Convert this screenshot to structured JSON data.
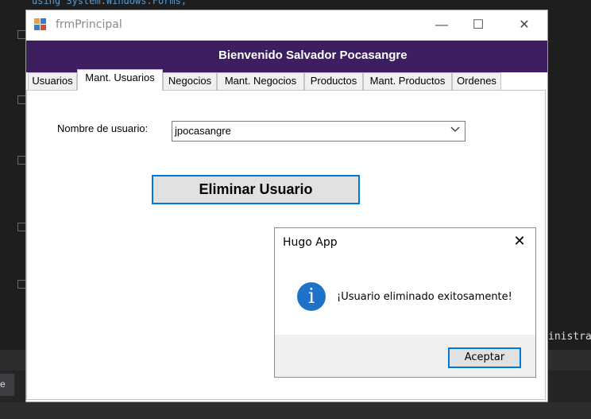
{
  "window": {
    "title": "frmPrincipal",
    "minimize": "—",
    "maximize": "☐",
    "close": "✕"
  },
  "header": {
    "welcome": "Bienvenido Salvador Pocasangre"
  },
  "tabs": [
    {
      "label": "Usuarios"
    },
    {
      "label": "Mant. Usuarios"
    },
    {
      "label": "Negocios"
    },
    {
      "label": "Mant. Negocios"
    },
    {
      "label": "Productos"
    },
    {
      "label": "Mant. Productos"
    },
    {
      "label": "Ordenes"
    }
  ],
  "form": {
    "user_label": "Nombre de usuario:",
    "user_value": "jpocasangre",
    "delete_button": "Eliminar Usuario"
  },
  "messagebox": {
    "title": "Hugo App",
    "message": "¡Usuario eliminado exitosamente!",
    "ok_button": "Aceptar",
    "close": "✕",
    "icon": "info-icon",
    "icon_glyph": "i"
  },
  "ide": {
    "code_fragment": "using System.Windows.Forms;",
    "right_text": "inistra",
    "tab_text": "e"
  },
  "colors": {
    "header_bg": "#3d1f5f",
    "accent": "#0078d7",
    "info_icon": "#1e73c8"
  }
}
